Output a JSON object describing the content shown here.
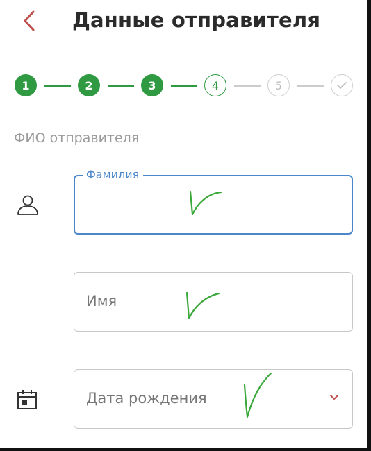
{
  "header": {
    "title": "Данные отправителя",
    "back_icon": "chevron-left-icon",
    "accent_color": "#c0504d"
  },
  "stepper": {
    "active_color": "#2f9a41",
    "inactive_color": "#cccccc",
    "steps": [
      {
        "label": "1",
        "state": "done"
      },
      {
        "label": "2",
        "state": "done"
      },
      {
        "label": "3",
        "state": "done"
      },
      {
        "label": "4",
        "state": "current"
      },
      {
        "label": "5",
        "state": "upcoming"
      },
      {
        "label": "",
        "icon": "check-icon",
        "state": "upcoming"
      }
    ]
  },
  "section": {
    "label": "ФИО отправителя"
  },
  "form": {
    "focus_color": "#4a86c9",
    "surname": {
      "label": "Фамилия",
      "value": "",
      "icon": "person-icon",
      "focused": true
    },
    "name": {
      "placeholder": "Имя",
      "value": ""
    },
    "birth_date": {
      "placeholder": "Дата рождения",
      "icon": "calendar-icon",
      "dropdown_icon": "chevron-down-icon"
    }
  },
  "annotations": {
    "handwritten_marks": "green-checkmark",
    "mark_color": "#3aa83a"
  }
}
